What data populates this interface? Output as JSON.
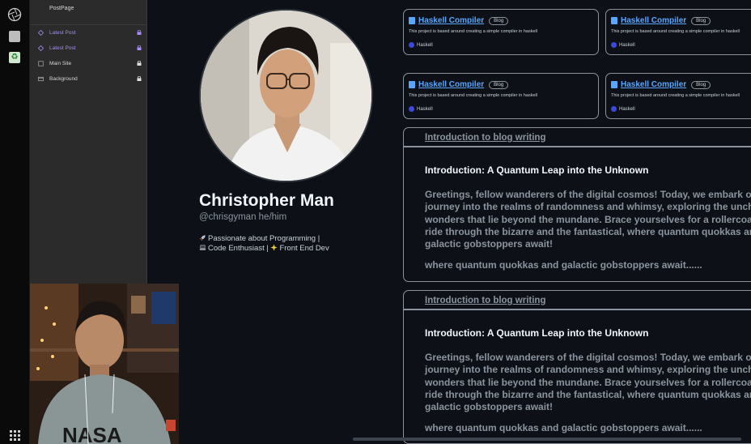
{
  "sidebar": {
    "title": "PostPage",
    "items": [
      {
        "label": "Latest Post",
        "color": "#a78bfa",
        "icon": "diamond-icon"
      },
      {
        "label": "Latest Post",
        "color": "#a78bfa",
        "icon": "diamond-icon"
      },
      {
        "label": "Main Site",
        "color": "#d6d6d6",
        "icon": "page-icon"
      },
      {
        "label": "Background",
        "color": "#d6d6d6",
        "icon": "window-icon"
      }
    ]
  },
  "profile": {
    "name": "Christopher Man",
    "handle": "@chrisgyman he/him",
    "bio_line1": "Passionate about Programming |",
    "bio_line2a": "Code Enthusiast |",
    "bio_line2b": "Front End Dev"
  },
  "repos": [
    {
      "title": "Haskell Compiler",
      "badge": "Blog",
      "description": "This project is based around creating a simple compiler in haskell",
      "language": "Haskell"
    },
    {
      "title": "Haskell Compiler",
      "badge": "Blog",
      "description": "This project is based around creating a simple compiler in haskell",
      "language": "Haskell"
    },
    {
      "title": "Haskell Compiler",
      "badge": "Blog",
      "description": "This project is based around creating a simple compiler in haskell",
      "language": "Haskell"
    },
    {
      "title": "Haskell Compiler",
      "badge": "Blog",
      "description": "This project is based around creating a simple compiler in haskell",
      "language": "Haskell"
    }
  ],
  "posts": [
    {
      "link": "Introduction to blog writing",
      "heading": "Introduction: A Quantum Leap into the Unknown",
      "lines": [
        "Greetings, fellow wanderers of the digital cosmos! Today, we embark on",
        "journey into the realms of randomness and whimsy, exploring the uncha",
        "wonders that lie beyond the mundane. Brace yourselves for a rollercoas",
        "ride through the bizarre and the fantastical, where quantum quokkas an",
        "galactic gobstoppers await!"
      ],
      "tagline": "where quantum quokkas and galactic gobstoppers await......"
    },
    {
      "link": "Introduction to blog writing",
      "heading": "Introduction: A Quantum Leap into the Unknown",
      "lines": [
        "Greetings, fellow wanderers of the digital cosmos! Today, we embark on",
        "journey into the realms of randomness and whimsy, exploring the uncha",
        "wonders that lie beyond the mundane. Brace yourselves for a rollercoas",
        "ride through the bizarre and the fantastical, where quantum quokkas an",
        "galactic gobstoppers await!"
      ],
      "tagline": "where quantum quokkas and galactic gobstoppers await......"
    }
  ],
  "colors": {
    "background": "#0d1117",
    "link_blue": "#58a6ff",
    "language_dot": "#3b49df",
    "sidebar_accent": "#a78bfa"
  }
}
